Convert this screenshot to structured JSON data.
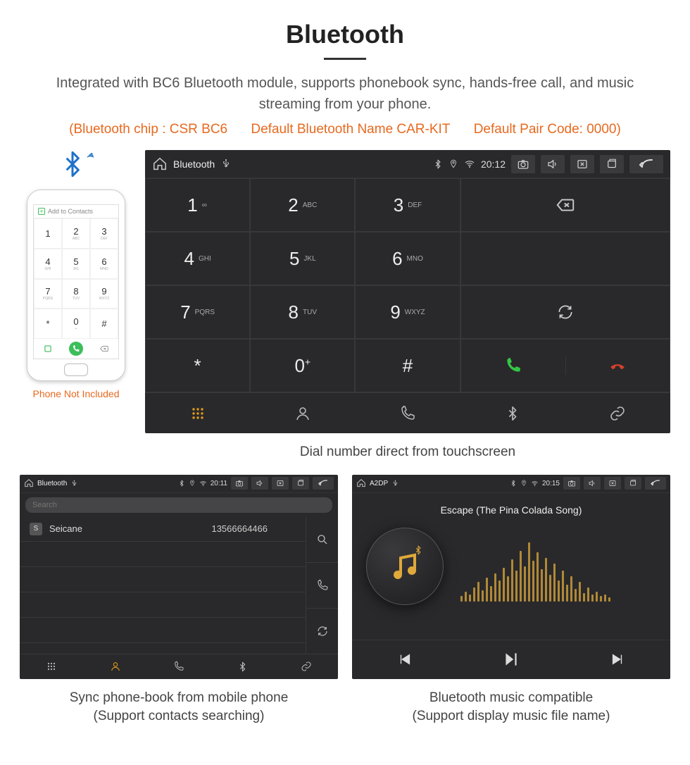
{
  "title": "Bluetooth",
  "description": "Integrated with BC6 Bluetooth module, supports phonebook sync, hands-free call, and music streaming from your phone.",
  "specs": {
    "chip": "(Bluetooth chip : CSR BC6",
    "name": "Default Bluetooth Name CAR-KIT",
    "code": "Default Pair Code: 0000)"
  },
  "phoneNotIncluded": "Phone Not Included",
  "phoneAddContacts": "Add to Contacts",
  "phoneKeypad": [
    {
      "n": "1",
      "l": ""
    },
    {
      "n": "2",
      "l": "ABC"
    },
    {
      "n": "3",
      "l": "DEF"
    },
    {
      "n": "4",
      "l": "GHI"
    },
    {
      "n": "5",
      "l": "JKL"
    },
    {
      "n": "6",
      "l": "MNO"
    },
    {
      "n": "7",
      "l": "PQRS"
    },
    {
      "n": "8",
      "l": "TUV"
    },
    {
      "n": "9",
      "l": "WXYZ"
    },
    {
      "n": "*",
      "l": ""
    },
    {
      "n": "0",
      "l": "+"
    },
    {
      "n": "#",
      "l": ""
    }
  ],
  "dialer": {
    "statusTitle": "Bluetooth",
    "time": "20:12",
    "keys": [
      {
        "d": "1",
        "l": "",
        "dots": true
      },
      {
        "d": "2",
        "l": "ABC"
      },
      {
        "d": "3",
        "l": "DEF"
      },
      {
        "d": "4",
        "l": "GHI"
      },
      {
        "d": "5",
        "l": "JKL"
      },
      {
        "d": "6",
        "l": "MNO"
      },
      {
        "d": "7",
        "l": "PQRS"
      },
      {
        "d": "8",
        "l": "TUV"
      },
      {
        "d": "9",
        "l": "WXYZ"
      },
      {
        "d": "*",
        "l": ""
      },
      {
        "d": "0",
        "l": "",
        "plus": true
      },
      {
        "d": "#",
        "l": ""
      }
    ],
    "caption": "Dial number direct from touchscreen"
  },
  "contacts": {
    "statusTitle": "Bluetooth",
    "time": "20:11",
    "searchPlaceholder": "Search",
    "list": [
      {
        "badge": "S",
        "name": "Seicane",
        "number": "13566664466"
      }
    ],
    "caption1": "Sync phone-book from mobile phone",
    "caption2": "(Support contacts searching)"
  },
  "music": {
    "statusTitle": "A2DP",
    "time": "20:15",
    "song": "Escape (The Pina Colada Song)",
    "vizHeights": [
      8,
      14,
      10,
      20,
      28,
      16,
      34,
      22,
      40,
      30,
      48,
      36,
      60,
      44,
      72,
      50,
      84,
      58,
      70,
      46,
      62,
      38,
      54,
      30,
      44,
      24,
      36,
      18,
      28,
      12,
      20,
      10,
      14,
      8,
      10,
      6
    ],
    "caption1": "Bluetooth music compatible",
    "caption2": "(Support display music file name)"
  }
}
